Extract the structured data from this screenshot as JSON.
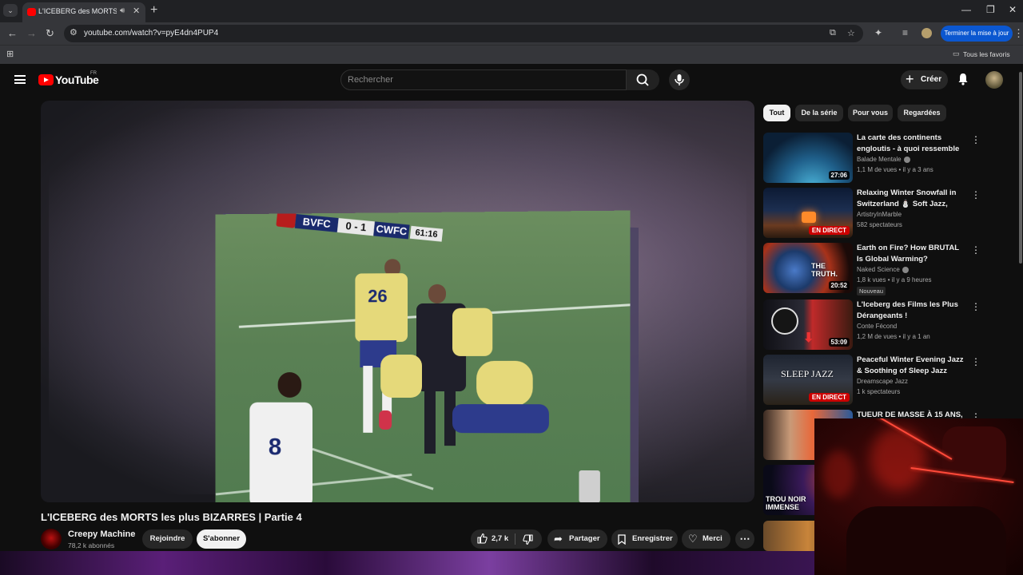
{
  "browser": {
    "tab_title": "L'ICEBERG des MORTS les p",
    "url": "youtube.com/watch?v=pyE4dn4PUP4",
    "update_button": "Terminer la mise à jour",
    "bookmarks_label": "Tous les favoris"
  },
  "youtube": {
    "logo_text": "YouTube",
    "region": "FR",
    "search_placeholder": "Rechercher",
    "create_label": "Créer"
  },
  "video": {
    "scoreboard": {
      "home": "BVFC",
      "score": "0 - 1",
      "away": "CWFC",
      "clock": "61:16"
    },
    "jersey_numbers": [
      "26",
      "8"
    ],
    "title": "L'ICEBERG des MORTS les plus BIZARRES | Partie 4",
    "channel": "Creepy Machine",
    "subscribers": "78,2 k abonnés",
    "join_label": "Rejoindre",
    "subscribe_label": "S'abonner",
    "likes": "2,7 k",
    "share_label": "Partager",
    "save_label": "Enregistrer",
    "thanks_label": "Merci"
  },
  "chips": [
    "Tout",
    "De la série",
    "Pour vous",
    "Regardées"
  ],
  "recommendations": [
    {
      "title": "La carte des continents engloutis - à quoi ressemble la...",
      "channel": "Balade Mentale",
      "meta": "1,1 M de vues • il y a 3 ans",
      "duration": "27:06"
    },
    {
      "title": "Relaxing Winter Snowfall in Switzerland ⛄ Soft Jazz, Coz...",
      "channel": "ArtistryInMarble",
      "meta": "582 spectateurs",
      "live": "EN DIRECT"
    },
    {
      "title": "Earth on Fire? How BRUTAL Is Global Warming?",
      "channel": "Naked Science",
      "meta": "1,8 k vues • il y a 9 heures",
      "duration": "20:52",
      "badge": "Nouveau",
      "overlay": "THE TRUTH."
    },
    {
      "title": "L'Iceberg des Films les Plus Dérangeants !",
      "channel": "Conte Fécond",
      "meta": "1,2 M de vues • il y a 1 an",
      "duration": "53:09"
    },
    {
      "title": "Peaceful Winter Evening Jazz & Soothing of Sleep Jazz Piano ...",
      "channel": "Dreamscape Jazz",
      "meta": "1 k spectateurs",
      "live": "EN DIRECT",
      "overlay": "SLEEP JAZZ"
    },
    {
      "title": "TUEUR DE MASSE À 15 ANS,"
    },
    {
      "overlay": "TROU NOIR IMMENSE"
    }
  ]
}
